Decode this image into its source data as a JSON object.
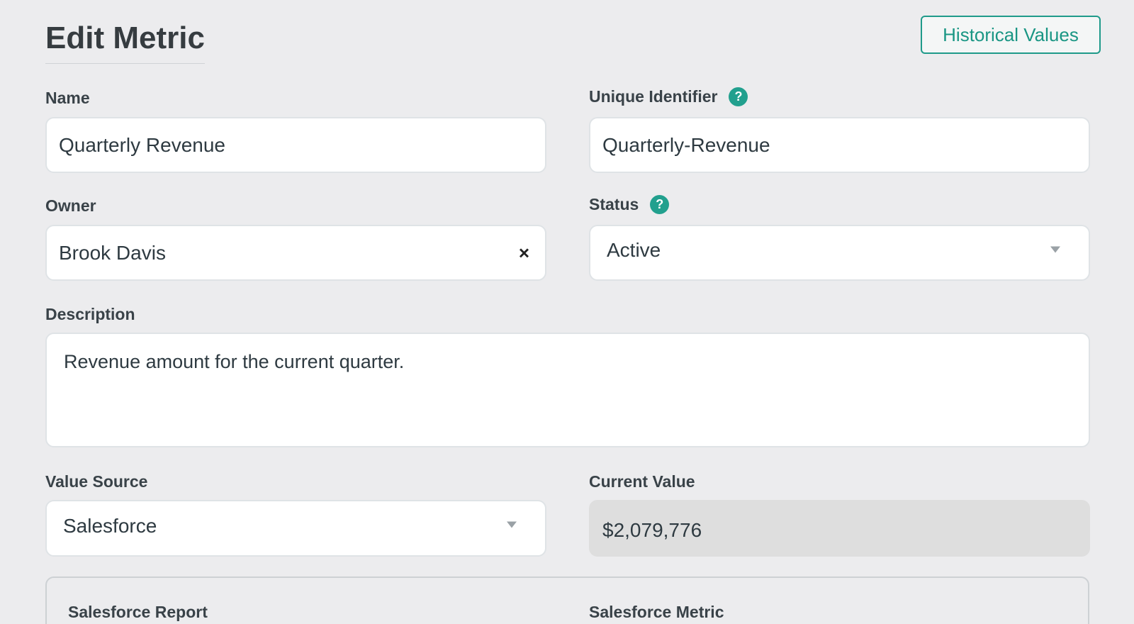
{
  "page": {
    "title": "Edit Metric",
    "historical_button": "Historical Values"
  },
  "fields": {
    "name": {
      "label": "Name",
      "value": "Quarterly Revenue"
    },
    "unique_identifier": {
      "label": "Unique Identifier",
      "value": "Quarterly-Revenue",
      "help_icon": "?"
    },
    "owner": {
      "label": "Owner",
      "value": "Brook Davis",
      "clear_icon": "×"
    },
    "status": {
      "label": "Status",
      "value": "Active",
      "help_icon": "?"
    },
    "description": {
      "label": "Description",
      "value": "Revenue amount for the current quarter."
    },
    "value_source": {
      "label": "Value Source",
      "value": "Salesforce"
    },
    "current_value": {
      "label": "Current Value",
      "value": "$2,079,776"
    }
  },
  "salesforce_panel": {
    "report_label": "Salesforce Report",
    "metric_label": "Salesforce Metric"
  },
  "colors": {
    "accent": "#1f9a8a",
    "background": "#ececee",
    "readonly_field": "#dedede"
  }
}
